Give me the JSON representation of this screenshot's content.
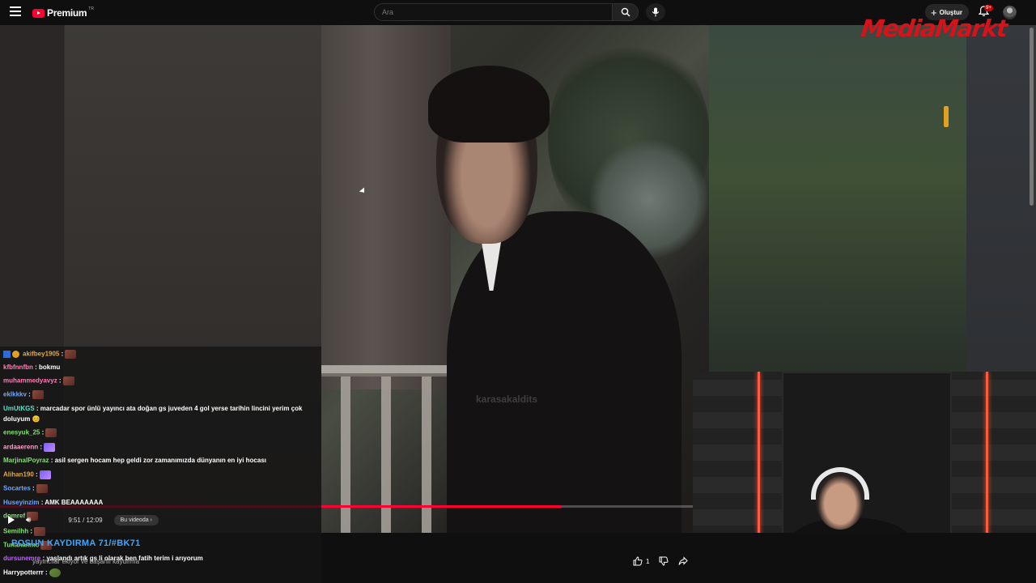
{
  "app": {
    "logo_text": "Premium",
    "logo_country": "TR",
    "search_placeholder": "Ara",
    "create_label": "Oluştur",
    "notification_badge": "9+"
  },
  "overlay": {
    "brand_logo": "MediaMarkt"
  },
  "video": {
    "watermark": "karasakaldits",
    "time": "9:51 / 12:09",
    "chapter_chip": "Bu videoda",
    "progress_fraction": 0.81,
    "like_count": "1"
  },
  "ticker": {
    "text_blue": "POSUN KAYDIRMA 71/#BK71",
    "text_partial": "yayıncılar ekiyor ve başarılı kaydırma"
  },
  "chat": [
    {
      "name": "akifbey1905",
      "sep": " :",
      "msg": "",
      "color": "#e0a94a",
      "emote": "brown",
      "icons": true
    },
    {
      "name": "kfbfnnfbn",
      "sep": " :",
      "msg": " bokmu",
      "color": "#ff7eb9"
    },
    {
      "name": "muhammedyavyz",
      "sep": " :",
      "msg": "",
      "color": "#ff7eb9",
      "emote": "brown"
    },
    {
      "name": "eklkkkv",
      "sep": " :",
      "msg": "",
      "color": "#6fa8ff",
      "emote": "brown"
    },
    {
      "name": "UmUtKGS",
      "sep": " :",
      "msg": " marcadar spor ünlü yayıncı ata doğan gs juveden 4 gol yerse tarihin lincini yerim çok",
      "color": "#5ce0c8"
    },
    {
      "name": "",
      "sep": "",
      "msg": "doluyum 😊",
      "color": "#fff"
    },
    {
      "name": "enesyuk_25",
      "sep": " :",
      "msg": "",
      "color": "#7de36b",
      "emote": "brown"
    },
    {
      "name": "ardaaerenn",
      "sep": " :",
      "msg": "",
      "color": "#ff9ecf",
      "emote": "purple"
    },
    {
      "name": "MarjinalPoyraz",
      "sep": " :",
      "msg": " asil sergen hocam hep geldi zor zamanımızda dünyanın en iyi hocası",
      "color": "#7de36b"
    },
    {
      "name": "Alihan190",
      "sep": " :",
      "msg": "",
      "color": "#e0a94a",
      "emote": "purple"
    },
    {
      "name": "Socartes",
      "sep": " :",
      "msg": "",
      "color": "#6fa8ff",
      "emote": "brown"
    },
    {
      "name": "Huseyinzim",
      "sep": " :",
      "msg": " AMK BEAAAAAAA",
      "color": "#6fa8ff"
    },
    {
      "name": "domref",
      "sep": "",
      "msg": "",
      "color": "#7de36b",
      "emote": "brown"
    },
    {
      "name": "Semilhh",
      "sep": " :",
      "msg": "",
      "color": "#7de36b",
      "emote": "brown"
    },
    {
      "name": "Tunahanmc",
      "sep": "",
      "msg": "",
      "color": "#7de36b",
      "emote": "brown"
    },
    {
      "name": "dursunemre",
      "sep": " :",
      "msg": " yaşlandı artık gs li olarak ben fatih terim i arıyorum",
      "color": "#c060ff"
    },
    {
      "name": "Harrypotterrr",
      "sep": " :",
      "msg": "",
      "color": "#fff",
      "emote": "green"
    }
  ],
  "icons": {
    "menu": "hamburger-icon",
    "search": "search-icon",
    "mic": "mic-icon",
    "bell": "bell-icon",
    "like": "thumbs-up-icon",
    "dislike": "thumbs-down-icon",
    "share": "share-icon"
  },
  "colors": {
    "accent": "#ff0033",
    "brand_overlay": "#d8121a"
  }
}
